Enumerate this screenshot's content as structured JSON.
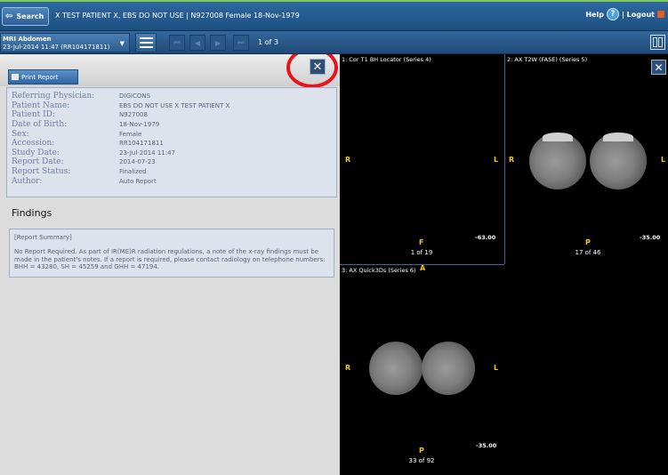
{
  "header": {
    "search_label": "Search",
    "patient_banner": "X TEST PATIENT X, EBS DO NOT USE | N927008 Female 18-Nov-1979",
    "help_label": "Help",
    "logout_label": "| Logout"
  },
  "study_bar": {
    "study_name": "MRI Abdomen",
    "study_detail": "23-Jul-2014 11:47 (RR104171811)",
    "page_indicator": "1 of 3"
  },
  "report": {
    "print_label": "Print Report",
    "fields": [
      {
        "label": "Referring Physician:",
        "value": "DIGICONS"
      },
      {
        "label": "Patient Name:",
        "value": "EBS DO NOT USE X TEST PATIENT X"
      },
      {
        "label": "Patient ID:",
        "value": "N927008"
      },
      {
        "label": "Date of Birth:",
        "value": "18-Nov-1979"
      },
      {
        "label": "Sex:",
        "value": "Female"
      },
      {
        "label": "Accession:",
        "value": "RR104171811"
      },
      {
        "label": "Study Date:",
        "value": "23-Jul-2014 11:47"
      },
      {
        "label": "Report Date:",
        "value": "2014-07-23"
      },
      {
        "label": "Report Status:",
        "value": "Finalized"
      },
      {
        "label": "Author:",
        "value": "Auto Report"
      }
    ],
    "findings_title": "Findings",
    "summary_title": "[Report Summary]",
    "summary_text": "No Report Required. As part of IR(ME)R radiation regulations, a note of the x-ray findings must be made in the patient's notes. If a report is required, please contact radiology on telephone numbers: BHH = 43280, SH = 45259 and GHH = 47194."
  },
  "viewer": {
    "tiles": [
      {
        "title": "1: Cor T1 BH Locator (Series 4)",
        "left": "R",
        "right": "L",
        "bottom": "F",
        "position": "-63.00",
        "count": "1 of 19"
      },
      {
        "title": "2: AX T2W (FASE) (Series 5)",
        "left": "R",
        "right": "L",
        "bottom": "P",
        "position": "-35.00",
        "count": "17 of 46"
      },
      {
        "title": "3: AX Quick3Ds (Series 6)",
        "top": "A",
        "left": "R",
        "right": "L",
        "bottom": "P",
        "position": "-35.00",
        "count": "33 of 92"
      }
    ]
  },
  "colors": {
    "accent": "#2f6aa0",
    "annotation": "#e8141c",
    "orientation_marker": "#f4c81e"
  }
}
